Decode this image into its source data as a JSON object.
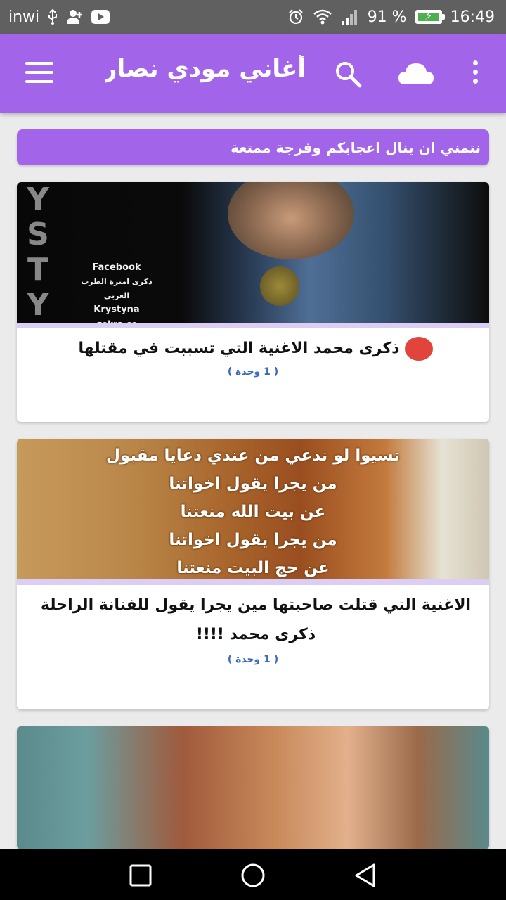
{
  "status_bar": {
    "carrier": "inwi",
    "battery_percent": "91 %",
    "time": "16:49"
  },
  "app_bar": {
    "title": "أغاني مودي نصار ...",
    "icons": [
      "menu-icon",
      "search-icon",
      "cloud-icon",
      "more-vert-icon"
    ]
  },
  "banner": {
    "text": "نتمني ان ينال اعجابكم وفرجة ممتعة"
  },
  "cards": [
    {
      "title": "ذكرى محمد الاغنية التي تسببت في مقتلها",
      "meta": "( 1 وحدة )",
      "thumb_letters": [
        "Y",
        "S",
        "T",
        "Y"
      ],
      "thumb_text": [
        "Facebook",
        "ذكرى اميرة الطرب العربي",
        "Krystyna",
        "zekra.cc"
      ]
    },
    {
      "title": "الاغنية التي قتلت صاحبتها مين يجرا يقول للفنانة الراحلة ذكرى محمد !!!!",
      "meta": "( 1 وحدة )",
      "thumb_lines": [
        "نسيوا لو ندعي من عندي دعايا مقبول",
        "من يجرا يقول اخواتنا",
        "عن بيت الله منعتنا",
        "من يجرا يقول اخواتنا",
        "عن حج البيت منعتنا"
      ]
    },
    {
      "title": "",
      "meta": ""
    }
  ],
  "colors": {
    "primary": "#a264e8",
    "status_bar": "#606060",
    "card_separator": "#dccdf5",
    "meta_text": "#3a6ab8",
    "red_dot": "#e0443a"
  }
}
